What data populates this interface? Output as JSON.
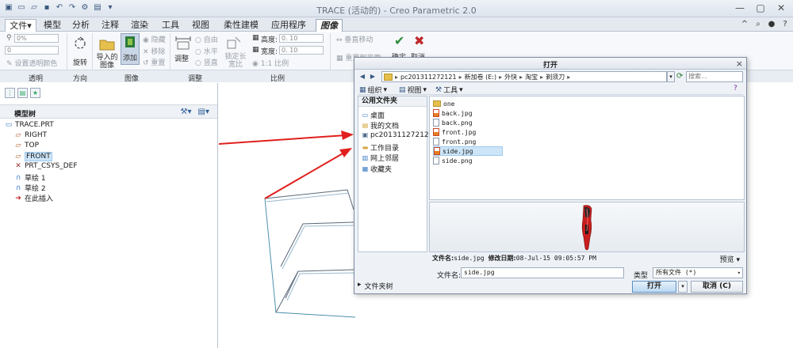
{
  "window": {
    "title": "TRACE (活动的) - Creo Parametric 2.0"
  },
  "ribbon_tabs": [
    {
      "label": "文件",
      "dropdown": "▾"
    },
    {
      "label": "模型"
    },
    {
      "label": "分析"
    },
    {
      "label": "注释"
    },
    {
      "label": "渲染"
    },
    {
      "label": "工具"
    },
    {
      "label": "视图"
    },
    {
      "label": "柔性建模"
    },
    {
      "label": "应用程序"
    },
    {
      "label": "图像"
    }
  ],
  "ribbon": {
    "transparency_value": "0%",
    "transparency_value2": "0",
    "set_transparent_color": "设置透明颜色",
    "rotate": "旋转",
    "import_image": "导入的图像",
    "add": "添加",
    "hide": "隐藏",
    "remove": "移除",
    "reset": "重置",
    "adjust": "调整",
    "free": "自由",
    "horizontal": "水平",
    "vertical": "竖直",
    "lock_aspect": "锁定长宽比",
    "height_label": "高度:",
    "height_value": "0. 10",
    "width_label": "宽度:",
    "width_value": "0. 10",
    "ratio": "1:1 比例",
    "vertical_move": "垂直移动",
    "reset_layout": "重置到平面",
    "confirm": "确定",
    "cancel": "取消",
    "groups": [
      "透明",
      "方向",
      "图像",
      "调整",
      "比例"
    ]
  },
  "left_panel": {
    "title": "模型树",
    "items": [
      {
        "label": "TRACE.PRT",
        "icon": "part-icon"
      },
      {
        "label": "RIGHT",
        "icon": "datum-plane-icon"
      },
      {
        "label": "TOP",
        "icon": "datum-plane-icon"
      },
      {
        "label": "FRONT",
        "icon": "datum-plane-icon"
      },
      {
        "label": "PRT_CSYS_DEF",
        "icon": "csys-icon"
      },
      {
        "label": "草绘 1",
        "icon": "sketch-icon"
      },
      {
        "label": "草绘 2",
        "icon": "sketch-icon"
      },
      {
        "label": "在此插入",
        "icon": "insert-arrow-icon"
      }
    ]
  },
  "dialog": {
    "title": "打开",
    "path": [
      "pc201311272121",
      "新加卷 (E:)",
      "外快",
      "淘宝",
      "剃须刀"
    ],
    "search_placeholder": "搜索...",
    "toolbar": {
      "organize": "组织",
      "view": "视图",
      "tools": "工具"
    },
    "places_header": "公用文件夹",
    "places": [
      {
        "label": "桌面",
        "icon": "desktop-icon"
      },
      {
        "label": "我的文档",
        "icon": "documents-icon"
      },
      {
        "label": "pc201311272121",
        "icon": "computer-icon"
      },
      {
        "label": "工作目录",
        "icon": "working-dir-icon"
      },
      {
        "label": "网上邻居",
        "icon": "network-icon"
      },
      {
        "label": "收藏夹",
        "icon": "favorites-icon"
      }
    ],
    "folder_tree": "文件夹树",
    "files": [
      {
        "name": "one",
        "type": "folder"
      },
      {
        "name": "back.jpg",
        "type": "jpg"
      },
      {
        "name": "back.png",
        "type": "png"
      },
      {
        "name": "front.jpg",
        "type": "jpg"
      },
      {
        "name": "front.png",
        "type": "png"
      },
      {
        "name": "side.jpg",
        "type": "jpg"
      },
      {
        "name": "side.png",
        "type": "png"
      }
    ],
    "selected_file": "side.jpg",
    "info": {
      "name_label": "文件名:",
      "name": "side.jpg",
      "date_label": "修改日期:",
      "date": "08-Jul-15 09:05:57 PM",
      "preview": "预览"
    },
    "filename_label": "文件名:",
    "filename_value": "side.jpg",
    "type_label": "类型",
    "type_value": "所有文件 (*)",
    "open": "打开",
    "cancel": "取消 (C)"
  }
}
